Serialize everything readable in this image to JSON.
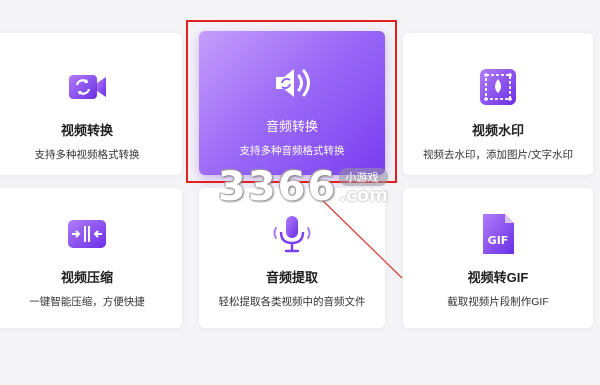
{
  "cards": [
    {
      "title": "视频转换",
      "desc": "支持多种视频格式转换",
      "icon": "video-convert-icon"
    },
    {
      "title": "音频转换",
      "desc": "支持多种音频格式转换",
      "icon": "audio-convert-icon"
    },
    {
      "title": "视频水印",
      "desc": "视频去水印，添加图片/文字水印",
      "icon": "video-watermark-icon"
    },
    {
      "title": "视频压缩",
      "desc": "一键智能压缩，方便快捷",
      "icon": "video-compress-icon"
    },
    {
      "title": "音频提取",
      "desc": "轻松提取各类视频中的音频文件",
      "icon": "audio-extract-icon"
    },
    {
      "title": "视频转GIF",
      "desc": "截取视频片段制作GIF",
      "icon": "video-to-gif-icon"
    }
  ],
  "watermark": {
    "number": "3366",
    "site_cn": "小游戏",
    "domain": ".com"
  },
  "colors": {
    "accent": "#8b5cf6",
    "accent_dark": "#7a3df0",
    "highlight": "#e0211d"
  }
}
